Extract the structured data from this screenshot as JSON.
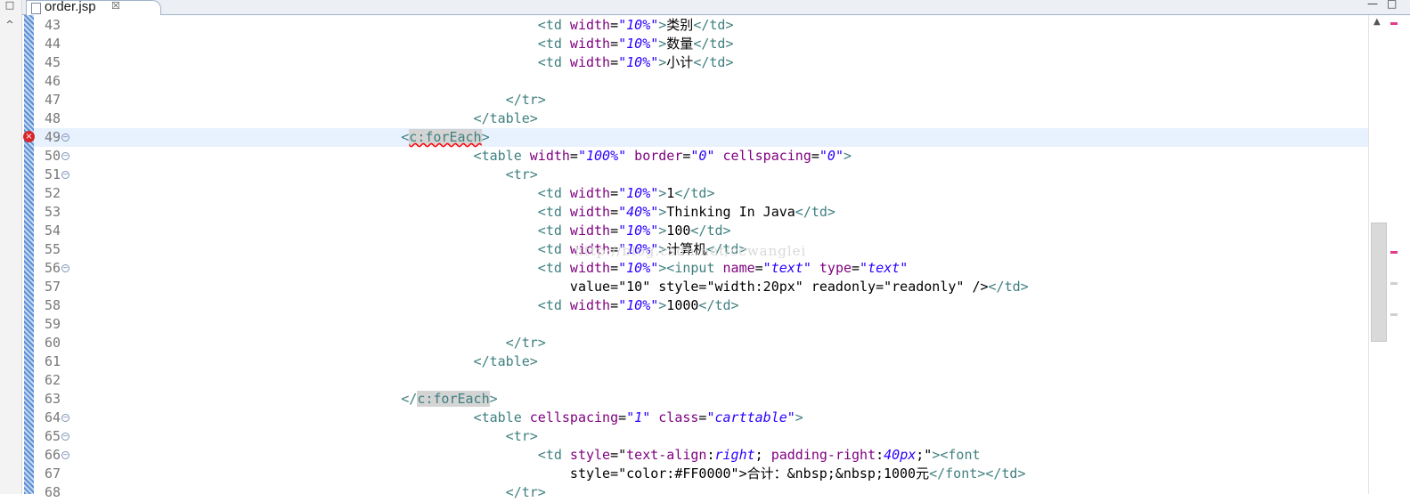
{
  "tab": {
    "label": "order.jsp",
    "close_glyph": "☒",
    "icon": "file-icon"
  },
  "window": {
    "minimize_glyph": "—",
    "maximize_glyph": "□"
  },
  "left_panel": {
    "restore_glyph": "□",
    "collapse_glyph": "^"
  },
  "watermark": "http://blog.csdn.net/ccwanglei",
  "lines": [
    {
      "n": "43",
      "code": "                                                          <td width=\"10%\">类别</td>"
    },
    {
      "n": "44",
      "code": "                                                          <td width=\"10%\">数量</td>"
    },
    {
      "n": "45",
      "code": "                                                          <td width=\"10%\">小计</td>"
    },
    {
      "n": "46",
      "code": ""
    },
    {
      "n": "47",
      "code": "                                                      </tr>"
    },
    {
      "n": "48",
      "code": "                                                  </table>"
    },
    {
      "n": "49",
      "code": "                                         <c:forEach>"
    },
    {
      "n": "50",
      "code": "                                                  <table width=\"100%\" border=\"0\" cellspacing=\"0\">"
    },
    {
      "n": "51",
      "code": "                                                      <tr>"
    },
    {
      "n": "52",
      "code": "                                                          <td width=\"10%\">1</td>"
    },
    {
      "n": "53",
      "code": "                                                          <td width=\"40%\">Thinking In Java</td>"
    },
    {
      "n": "54",
      "code": "                                                          <td width=\"10%\">100</td>"
    },
    {
      "n": "55",
      "code": "                                                          <td width=\"10%\">计算机</td>"
    },
    {
      "n": "56",
      "code": "                                                          <td width=\"10%\"><input name=\"text\" type=\"text\""
    },
    {
      "n": "57",
      "code": "                                                              value=\"10\" style=\"width:20px\" readonly=\"readonly\" /></td>"
    },
    {
      "n": "58",
      "code": "                                                          <td width=\"10%\">1000</td>"
    },
    {
      "n": "59",
      "code": ""
    },
    {
      "n": "60",
      "code": "                                                      </tr>"
    },
    {
      "n": "61",
      "code": "                                                  </table>"
    },
    {
      "n": "62",
      "code": ""
    },
    {
      "n": "63",
      "code": "                                         </c:forEach>"
    },
    {
      "n": "64",
      "code": "                                                  <table cellspacing=\"1\" class=\"carttable\">"
    },
    {
      "n": "65",
      "code": "                                                      <tr>"
    },
    {
      "n": "66",
      "code": "                                                          <td style=\"text-align:right; padding-right:40px;\"><font"
    },
    {
      "n": "67",
      "code": "                                                              style=\"color:#FF0000\">合计：&nbsp;&nbsp;1000元</font></td>"
    },
    {
      "n": "68",
      "code": "                                                      </tr>"
    }
  ],
  "current_line": "49",
  "error_line": "49",
  "fold_lines": [
    "49",
    "50",
    "51",
    "56",
    "64",
    "65",
    "66"
  ],
  "colors": {
    "tag": "#3f7f7f",
    "attribute": "#7f007f",
    "value": "#2a00ff",
    "text": "#000000",
    "current_line_bg": "#e8f2fe",
    "error": "#d8262b",
    "change_bar": "#5b8fd4"
  }
}
